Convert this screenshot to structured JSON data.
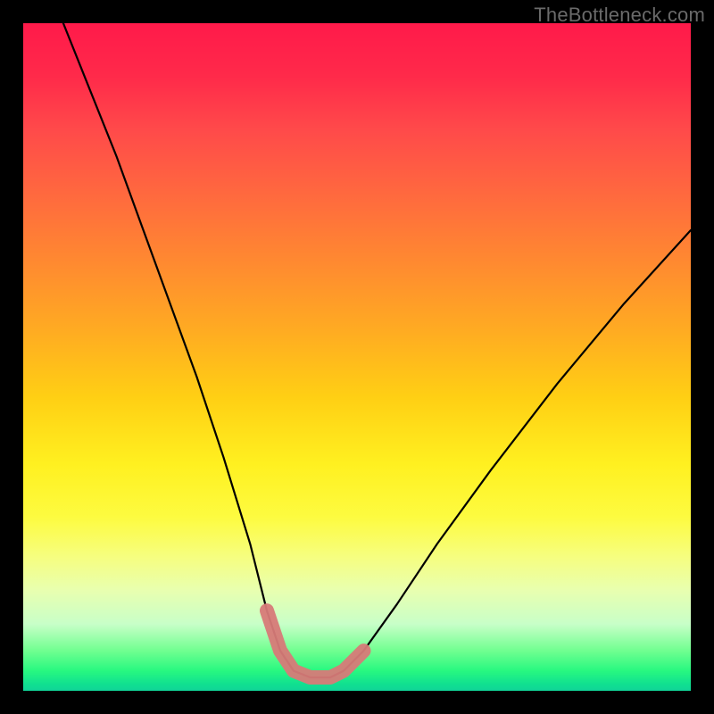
{
  "watermark": {
    "text": "TheBottleneck.com"
  },
  "chart_data": {
    "type": "line",
    "title": "",
    "xlabel": "",
    "ylabel": "",
    "xlim": [
      0,
      100
    ],
    "ylim": [
      0,
      100
    ],
    "series": [
      {
        "name": "bottleneck-curve",
        "x": [
          6,
          10,
          14,
          18,
          22,
          26,
          30,
          34,
          36.5,
          38.5,
          40.5,
          43,
          46,
          48,
          51,
          56,
          62,
          70,
          80,
          90,
          100
        ],
        "y": [
          100,
          90,
          80,
          69,
          58,
          47,
          35,
          22,
          12,
          6,
          3,
          2,
          2,
          3,
          6,
          13,
          22,
          33,
          46,
          58,
          69
        ]
      },
      {
        "name": "optimal-band",
        "x": [
          36.5,
          38.5,
          40.5,
          43,
          46,
          48,
          51
        ],
        "y": [
          12,
          6,
          3,
          2,
          2,
          3,
          6
        ]
      }
    ],
    "gradient_stops": [
      {
        "pos": 0,
        "color": "#ff1a4a"
      },
      {
        "pos": 50,
        "color": "#ffcf14"
      },
      {
        "pos": 80,
        "color": "#f6fe80"
      },
      {
        "pos": 100,
        "color": "#10d498"
      }
    ]
  }
}
